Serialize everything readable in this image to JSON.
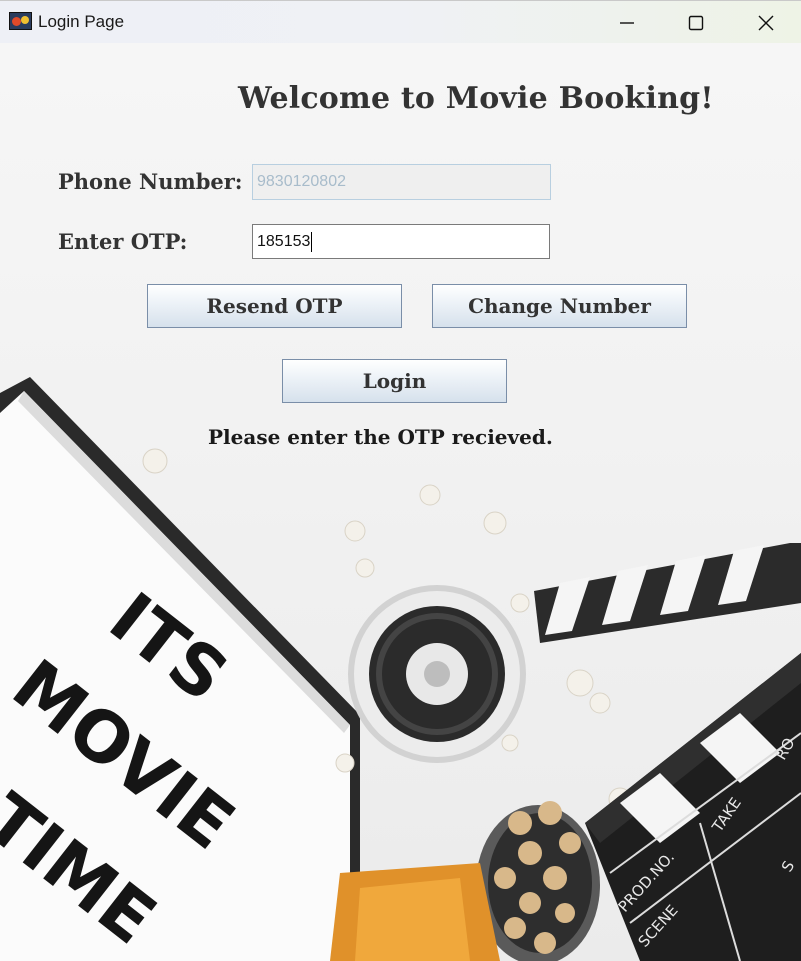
{
  "window": {
    "title": "Login Page",
    "controls": {
      "minimize": "minimize-icon",
      "maximize": "maximize-icon",
      "close": "close-icon"
    }
  },
  "main": {
    "heading": "Welcome to Movie Booking!",
    "phone": {
      "label": "Phone Number:",
      "value": "9830120802"
    },
    "otp": {
      "label": "Enter OTP:",
      "value": "185153"
    },
    "buttons": {
      "resend": "Resend OTP",
      "change_number": "Change Number",
      "login": "Login"
    },
    "status": "Please enter the OTP recieved."
  },
  "background": {
    "lightbox_text": [
      "ITS",
      "MOVIE",
      "TIME"
    ],
    "clapper_text": [
      "PROD.NO.",
      "SCENE",
      "TAKE",
      "RO",
      "S"
    ]
  },
  "colors": {
    "text": "#333333",
    "button_border": "#7a8ea8",
    "disabled_field_text": "#a8bccb"
  }
}
